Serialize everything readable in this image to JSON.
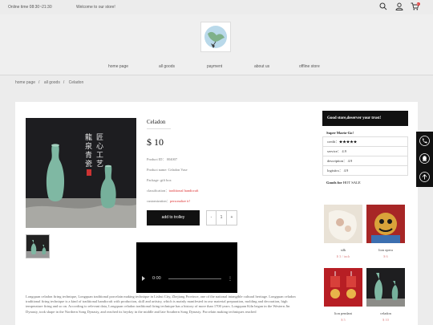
{
  "topbar": {
    "online_time": "Online time 08:30~21:30",
    "welcome": "Welcome to our store!",
    "cart_count": "0"
  },
  "nav": {
    "items": [
      "home page",
      "all goods",
      "payment",
      "about us",
      "offline store"
    ]
  },
  "breadcrumb": [
    "home page",
    "all goods",
    "Celadon"
  ],
  "product": {
    "title": "Celadon",
    "price": "$ 10",
    "id_label": "Product ID：",
    "id_value": "004007",
    "name": "Product name: Celadon Vase",
    "package": "Package: gift box",
    "classification_label": "classification：",
    "classification_value": "traditional handicraft",
    "customization_label": "customization：",
    "customization_value": "personalize it!",
    "add_label": "add to trolley",
    "minus": "-",
    "quantity": "1",
    "plus": "+"
  },
  "video": {
    "time": "0:00"
  },
  "description": "Longquan celadon firing technique, Longquan traditional porcelain making technique in Lishui City, Zhejiang Province, one of the national intangible cultural heritage. Longquan celadon traditional firing technique is a kind of traditional handicraft with production, skill and artistry, which is mainly manifested in raw material preparation, molding and decoration, high temperature firing and so on. According to relevant data, Longquan celadon traditional firing technique has a history of more than 1700 years. Longquan Kiln began in the Western Jin Dynasty, took shape in the Northern Song Dynasty, and reached its heyday in the middle and late Southern Song Dynasty. Porcelain making techniques reached",
  "sidebar": {
    "heading": "Good store,deserver your trust!",
    "shop_name": "Super Mario-Go!",
    "credit_label": "credit：",
    "credit_stars": "★★★★★",
    "service": "service： 4.9",
    "description": "description： 4.9",
    "logistics": "logistics： 4.9",
    "goods_for": "Goods for",
    "hot_sale": "HOT SALE",
    "items": [
      {
        "name": "silk",
        "price": "$ 3 / inch"
      },
      {
        "name": "lion opera",
        "price": "$ 6"
      },
      {
        "name": "lion pendant",
        "price": "$ 5"
      },
      {
        "name": "celadon",
        "price": "$ 10"
      }
    ]
  },
  "colors": {
    "accent": "#111111",
    "price_red": "#dd3333",
    "celadon": "#7fb8a3"
  }
}
